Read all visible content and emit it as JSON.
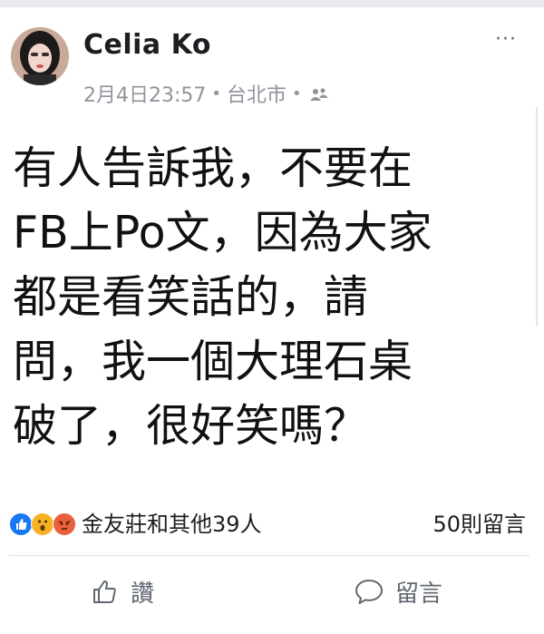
{
  "post": {
    "author": "Celia Ko",
    "timestamp": "2月4日23:57",
    "separator": "•",
    "location": "台北市",
    "privacy_icon": "friends-icon",
    "more_icon": "more-icon",
    "more_label": "···",
    "text": "有人告訴我，不要在\nFB上Po文，因為大家\n都是看笑話的，請\n問，我一個大理石桌\n破了，很好笑嗎？"
  },
  "reactions": {
    "icons": [
      "like-icon",
      "wow-icon",
      "angry-icon"
    ],
    "summary": "金友莊和其他39人",
    "comments": "50則留言"
  },
  "actions": {
    "like_label": "讚",
    "comment_label": "留言"
  },
  "colors": {
    "like_blue": "#1877f2",
    "wow_yellow": "#f7b125",
    "angry_orange": "#e8603c",
    "meta_gray": "#90949c"
  }
}
